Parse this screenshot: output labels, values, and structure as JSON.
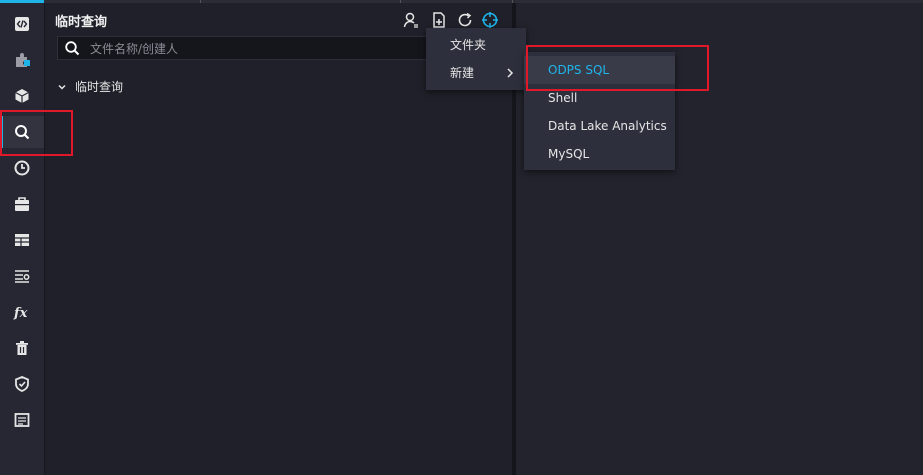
{
  "colors": {
    "accent": "#1fb4e8",
    "highlight_box": "#e0192a"
  },
  "sidebar": {
    "items": [
      {
        "icon": "code-icon"
      },
      {
        "icon": "puzzle-icon"
      },
      {
        "icon": "cube-icon"
      },
      {
        "icon": "search-icon",
        "active": true
      },
      {
        "icon": "clock-icon"
      },
      {
        "icon": "briefcase-icon"
      },
      {
        "icon": "table-icon"
      },
      {
        "icon": "list-settings-icon"
      },
      {
        "icon": "function-icon"
      },
      {
        "icon": "trash-icon"
      },
      {
        "icon": "shield-icon"
      },
      {
        "icon": "document-icon"
      }
    ]
  },
  "panel": {
    "title": "临时查询",
    "toolbar": [
      "user-icon",
      "new-file-icon",
      "refresh-icon",
      "locate-icon"
    ],
    "search": {
      "placeholder": "文件名称/创建人",
      "value": ""
    },
    "tree_root": "临时查询"
  },
  "menu": {
    "items": [
      {
        "label": "文件夹"
      },
      {
        "label": "新建",
        "has_submenu": true
      }
    ],
    "submenu": [
      {
        "label": "ODPS SQL",
        "highlighted": true
      },
      {
        "label": "Shell"
      },
      {
        "label": "Data Lake Analytics"
      },
      {
        "label": "MySQL"
      }
    ]
  }
}
